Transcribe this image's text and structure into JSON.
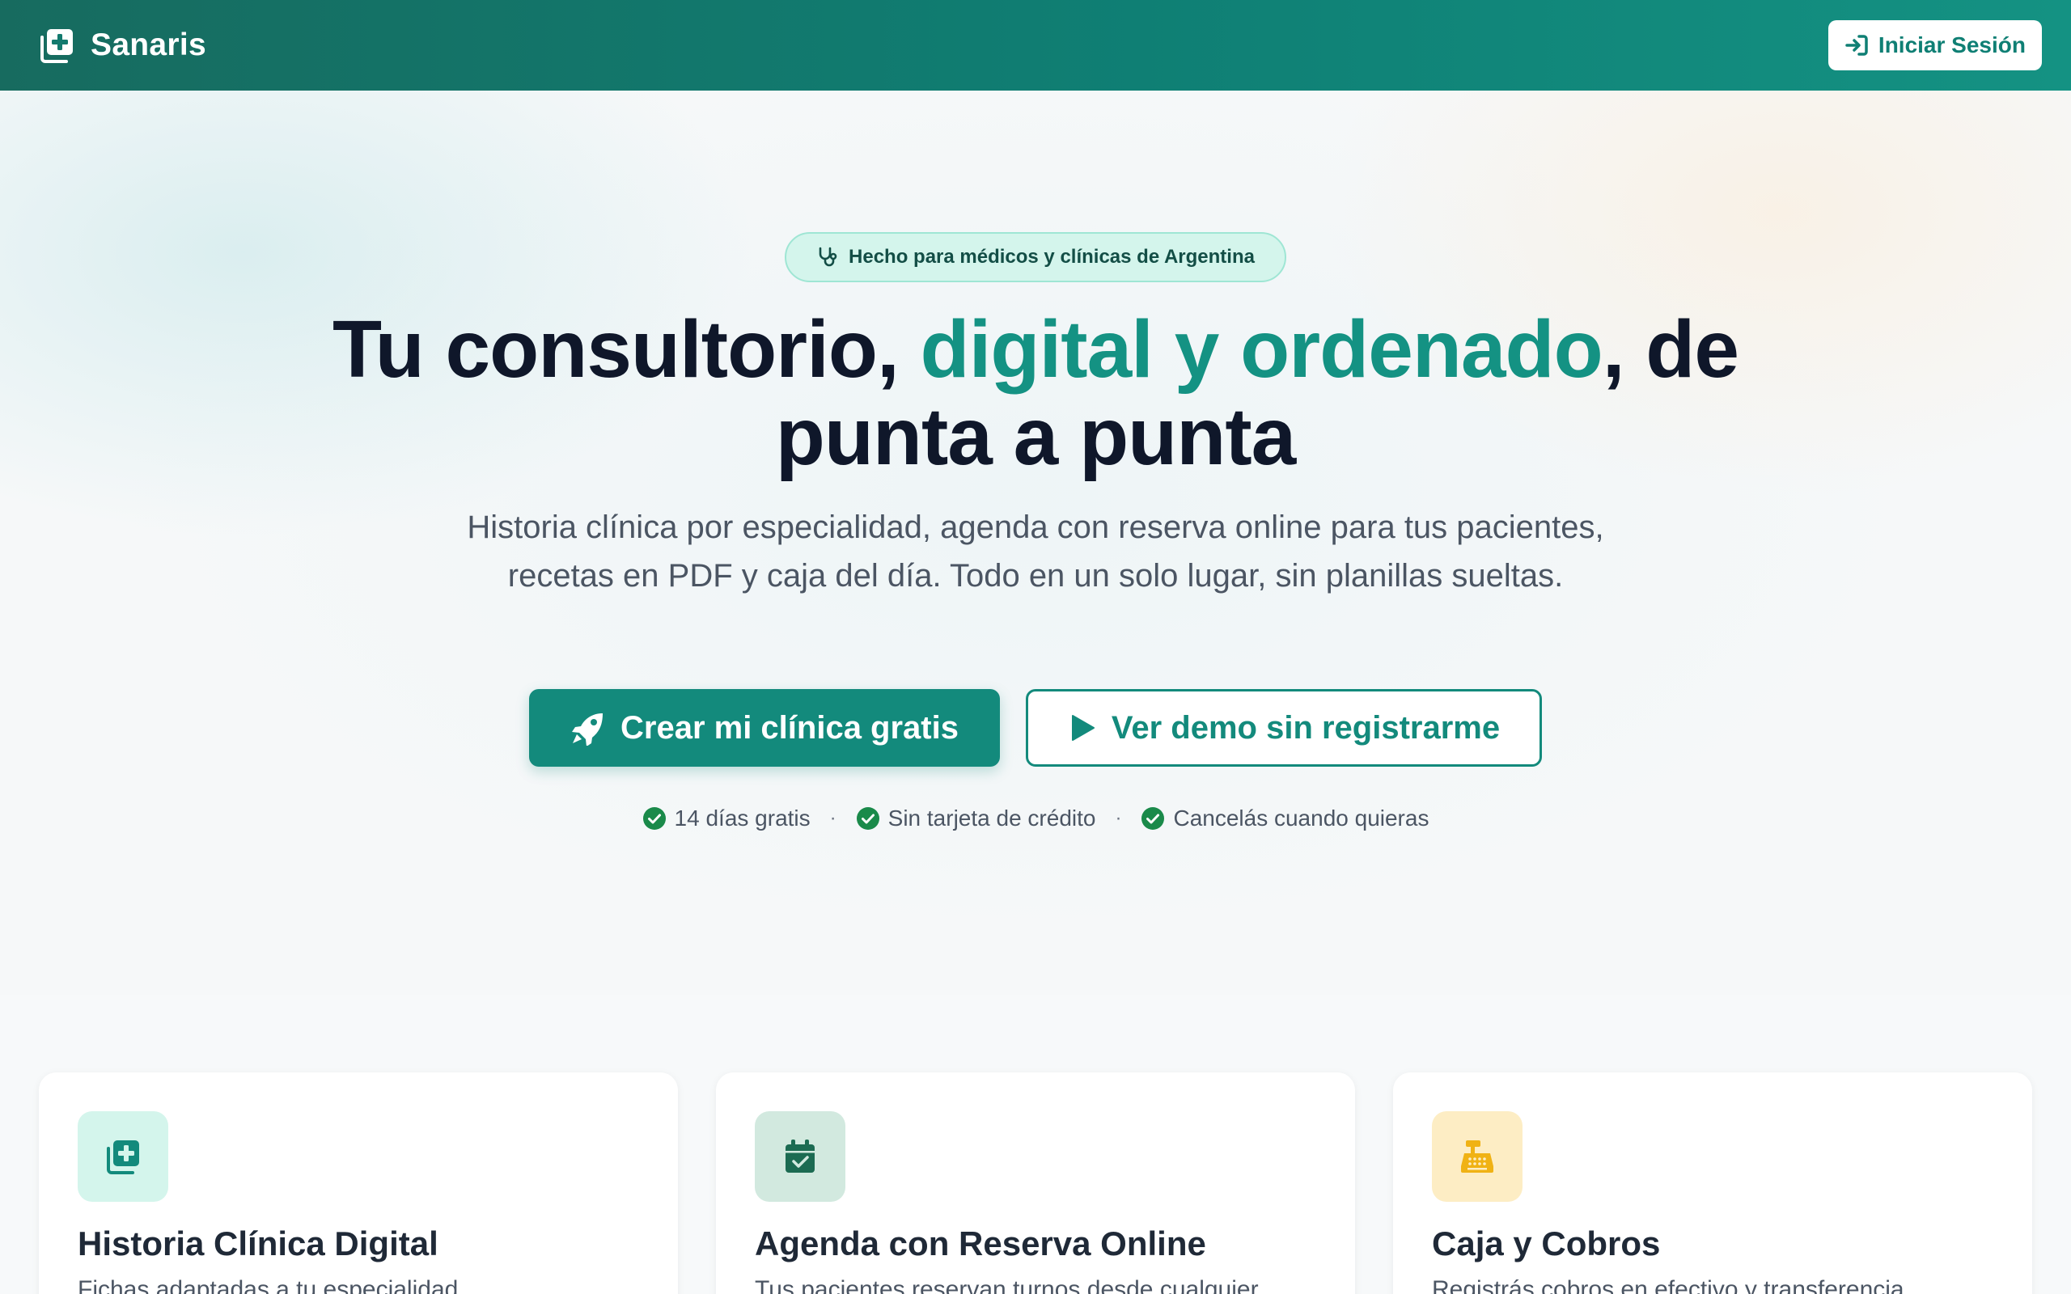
{
  "header": {
    "brand_name": "Sanaris",
    "brand_icon": "medical-folder-plus-icon",
    "login_label": "Iniciar Sesión",
    "login_icon": "sign-in-icon"
  },
  "hero": {
    "badge_text": "Hecho para médicos y clínicas de Argentina",
    "badge_icon": "stethoscope-icon",
    "headline_part1": "Tu consultorio, ",
    "headline_accent": "digital y ordenado",
    "headline_part2": ", de punta a punta",
    "subtitle": "Historia clínica por especialidad, agenda con reserva online para tus pacientes, recetas en PDF y caja del día. Todo en un solo lugar, sin planillas sueltas.",
    "cta_primary": "Crear mi clínica gratis",
    "cta_primary_icon": "rocket-icon",
    "cta_secondary": "Ver demo sin registrarme",
    "cta_secondary_icon": "play-icon",
    "perks": [
      "14 días gratis",
      "Sin tarjeta de crédito",
      "Cancelás cuando quieras"
    ],
    "separator": "·"
  },
  "features": [
    {
      "title": "Historia Clínica Digital",
      "description": "Fichas adaptadas a tu especialidad",
      "icon": "medical-folder-plus-icon",
      "icon_bg": "#d4f5ec",
      "icon_color": "#138a7c"
    },
    {
      "title": "Agenda con Reserva Online",
      "description": "Tus pacientes reservan turnos desde cualquier",
      "icon": "calendar-check-icon",
      "icon_bg": "#d2e9df",
      "icon_color": "#1c6b52"
    },
    {
      "title": "Caja y Cobros",
      "description": "Registrás cobros en efectivo y transferencia",
      "icon": "cash-register-icon",
      "icon_bg": "#fdedc4",
      "icon_color": "#f0b214"
    }
  ],
  "colors": {
    "brand": "#138a7c",
    "header_gradient_start": "#176b5f",
    "header_gradient_end": "#149283",
    "check": "#1a8a4a"
  }
}
